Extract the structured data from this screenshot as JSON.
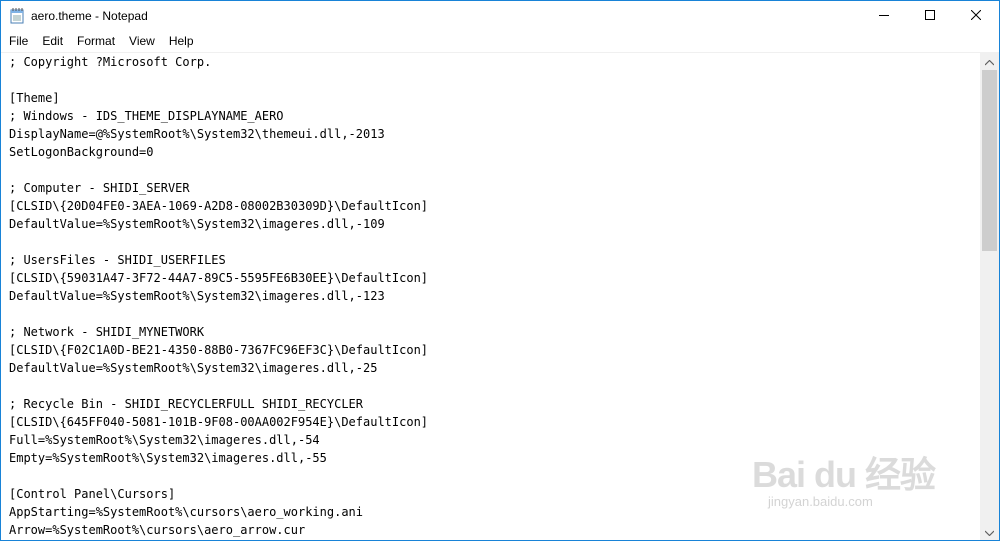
{
  "window": {
    "title": "aero.theme - Notepad"
  },
  "menu": [
    "File",
    "Edit",
    "Format",
    "View",
    "Help"
  ],
  "editor": {
    "lines": [
      "; Copyright ?Microsoft Corp.",
      "",
      "[Theme]",
      "; Windows - IDS_THEME_DISPLAYNAME_AERO",
      "DisplayName=@%SystemRoot%\\System32\\themeui.dll,-2013",
      "SetLogonBackground=0",
      "",
      "; Computer - SHIDI_SERVER",
      "[CLSID\\{20D04FE0-3AEA-1069-A2D8-08002B30309D}\\DefaultIcon]",
      "DefaultValue=%SystemRoot%\\System32\\imageres.dll,-109",
      "",
      "; UsersFiles - SHIDI_USERFILES",
      "[CLSID\\{59031A47-3F72-44A7-89C5-5595FE6B30EE}\\DefaultIcon]",
      "DefaultValue=%SystemRoot%\\System32\\imageres.dll,-123",
      "",
      "; Network - SHIDI_MYNETWORK",
      "[CLSID\\{F02C1A0D-BE21-4350-88B0-7367FC96EF3C}\\DefaultIcon]",
      "DefaultValue=%SystemRoot%\\System32\\imageres.dll,-25",
      "",
      "; Recycle Bin - SHIDI_RECYCLERFULL SHIDI_RECYCLER",
      "[CLSID\\{645FF040-5081-101B-9F08-00AA002F954E}\\DefaultIcon]",
      "Full=%SystemRoot%\\System32\\imageres.dll,-54",
      "Empty=%SystemRoot%\\System32\\imageres.dll,-55",
      "",
      "[Control Panel\\Cursors]",
      "AppStarting=%SystemRoot%\\cursors\\aero_working.ani",
      "Arrow=%SystemRoot%\\cursors\\aero_arrow.cur"
    ]
  },
  "watermark": {
    "main": "Bai du 经验",
    "sub": "jingyan.baidu.com"
  },
  "icons": {
    "app": "notepad-icon",
    "minimize": "minimize-icon",
    "maximize": "maximize-icon",
    "close": "close-icon",
    "scroll_up": "scroll-up-arrow-icon",
    "scroll_down": "scroll-down-arrow-icon"
  },
  "colors": {
    "window_border": "#1883d7",
    "scrollbar_track": "#f0f0f0",
    "scrollbar_thumb": "#cdcdcd"
  },
  "scroll": {
    "thumb_fraction": 0.4
  }
}
